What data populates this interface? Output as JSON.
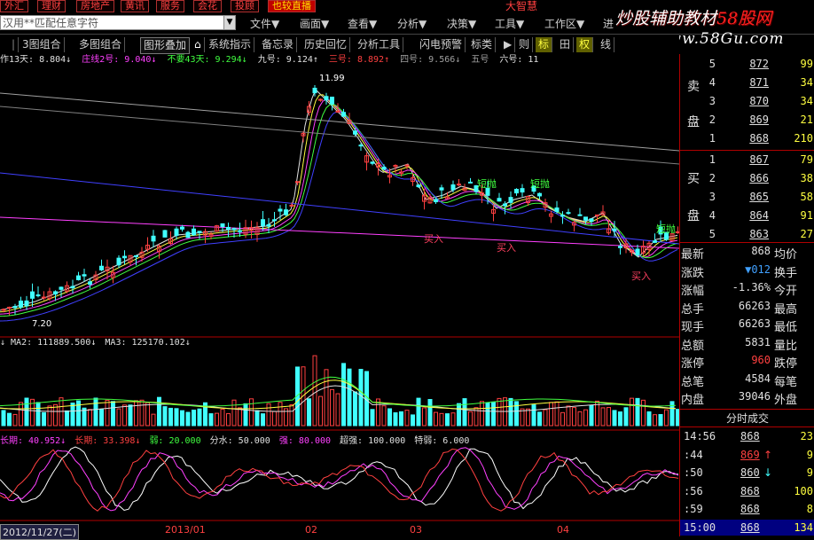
{
  "top_categories": [
    "外汇",
    "理财",
    "房地产",
    "黄讯",
    "服务",
    "会花",
    "投顾",
    "也较直播"
  ],
  "top_center": "大智慧",
  "search": {
    "placeholder": "汉用**匹配任意字符"
  },
  "menu": [
    "文件▼",
    "画面▼",
    "查看▼",
    "分析▼",
    "决策▼",
    "工具▼",
    "工作区▼",
    "进"
  ],
  "toolbar": [
    "3图组合",
    "多图组合",
    "图形叠加",
    "系统指示",
    "备忘录",
    "历史回忆",
    "分析工具",
    "闪电预警",
    "标类"
  ],
  "toolbar_right": [
    "▶",
    "则",
    "标",
    "田",
    "权",
    "线"
  ],
  "watermark": {
    "line1": "炒股辅助教材",
    "line1b": "58股网",
    "line2": "www.58Gu.com"
  },
  "indicator_line": [
    {
      "t": "作13天: 8.804↓",
      "c": "#e0e0e0"
    },
    {
      "t": "庄线2号: 9.040↓",
      "c": "#ff40ff"
    },
    {
      "t": "不要43天: 9.294↓",
      "c": "#40ff40"
    },
    {
      "t": "九号: 9.124↑",
      "c": "#e0e0e0"
    },
    {
      "t": "三号: 8.892↑",
      "c": "#ff4040"
    },
    {
      "t": "四号: 9.566↓",
      "c": "#a0a0a0"
    },
    {
      "t": "五号",
      "c": "#a0a0a0"
    },
    {
      "t": "六号: 11",
      "c": "#e0e0e0"
    }
  ],
  "annotations": {
    "high": "11.99",
    "low": "7.20",
    "sell_tag": "短抛",
    "buy_tag": "买入"
  },
  "ma_line": [
    {
      "t": "↓ MA2: 111889.500↓",
      "c": "#e0e0e0"
    },
    {
      "t": "MA3: 125170.102↓",
      "c": "#e0e0e0"
    }
  ],
  "osc_line": [
    {
      "t": "长期: 40.952↓",
      "c": "#ff40ff"
    },
    {
      "t": "长期: 33.398↓",
      "c": "#ff4040"
    },
    {
      "t": "弱: 20.000",
      "c": "#40ff40"
    },
    {
      "t": "分水: 50.000",
      "c": "#e0e0e0"
    },
    {
      "t": "强: 80.000",
      "c": "#ff40ff"
    },
    {
      "t": "超强: 100.000",
      "c": "#e0e0e0"
    },
    {
      "t": "特弱: 6.000",
      "c": "#e0e0e0"
    }
  ],
  "date_axis": [
    "2012/11/27(二)",
    "2013/01",
    "02",
    "03",
    "04"
  ],
  "orderbook": {
    "sell_label": [
      "卖",
      "盘"
    ],
    "buy_label": [
      "买",
      "盘"
    ],
    "sell": [
      {
        "lvl": "5",
        "price": "872",
        "vol": "99"
      },
      {
        "lvl": "4",
        "price": "871",
        "vol": "34"
      },
      {
        "lvl": "3",
        "price": "870",
        "vol": "34"
      },
      {
        "lvl": "2",
        "price": "869",
        "vol": "21"
      },
      {
        "lvl": "1",
        "price": "868",
        "vol": "210"
      }
    ],
    "buy": [
      {
        "lvl": "1",
        "price": "867",
        "vol": "79"
      },
      {
        "lvl": "2",
        "price": "866",
        "vol": "38"
      },
      {
        "lvl": "3",
        "price": "865",
        "vol": "58"
      },
      {
        "lvl": "4",
        "price": "864",
        "vol": "91"
      },
      {
        "lvl": "5",
        "price": "863",
        "vol": "27"
      }
    ]
  },
  "quote": [
    {
      "k": "最新",
      "v": "868",
      "vc": "#e0e0e0",
      "k2": "均价"
    },
    {
      "k": "涨跌",
      "v": "▼012",
      "vc": "#40a0ff",
      "k2": "换手"
    },
    {
      "k": "涨幅",
      "v": "-1.36%",
      "vc": "#e0e0e0",
      "k2": "今开"
    },
    {
      "k": "总手",
      "v": "66263",
      "vc": "#e0e0e0",
      "k2": "最高"
    },
    {
      "k": "现手",
      "v": "66263",
      "vc": "#e0e0e0",
      "k2": "最低"
    },
    {
      "k": "总额",
      "v": "5831",
      "vc": "#e0e0e0",
      "k2": "量比"
    },
    {
      "k": "涨停",
      "v": "960",
      "vc": "#ff4040",
      "k2": "跌停"
    },
    {
      "k": "总笔",
      "v": "4584",
      "vc": "#e0e0e0",
      "k2": "每笔"
    },
    {
      "k": "内盘",
      "v": "39046",
      "vc": "#e0e0e0",
      "k2": "外盘"
    }
  ],
  "ticks_title": "分时成交",
  "ticks": [
    {
      "t": "14:56",
      "p": "868",
      "pc": "#e0e0e0",
      "a": "",
      "v": "23"
    },
    {
      "t": ":44",
      "p": "869",
      "pc": "#ff4040",
      "a": "↑",
      "v": "9"
    },
    {
      "t": ":50",
      "p": "860",
      "pc": "#e0e0e0",
      "a": "↓",
      "v": "9"
    },
    {
      "t": ":56",
      "p": "868",
      "pc": "#e0e0e0",
      "a": "",
      "v": "100"
    },
    {
      "t": ":59",
      "p": "868",
      "pc": "#e0e0e0",
      "a": "",
      "v": "8"
    },
    {
      "t": "15:00",
      "p": "868",
      "pc": "#e0e0e0",
      "a": "",
      "v": "134"
    }
  ],
  "colors": {
    "up": "#ff4040",
    "down": "#40ffff",
    "accent": "#b00000"
  }
}
